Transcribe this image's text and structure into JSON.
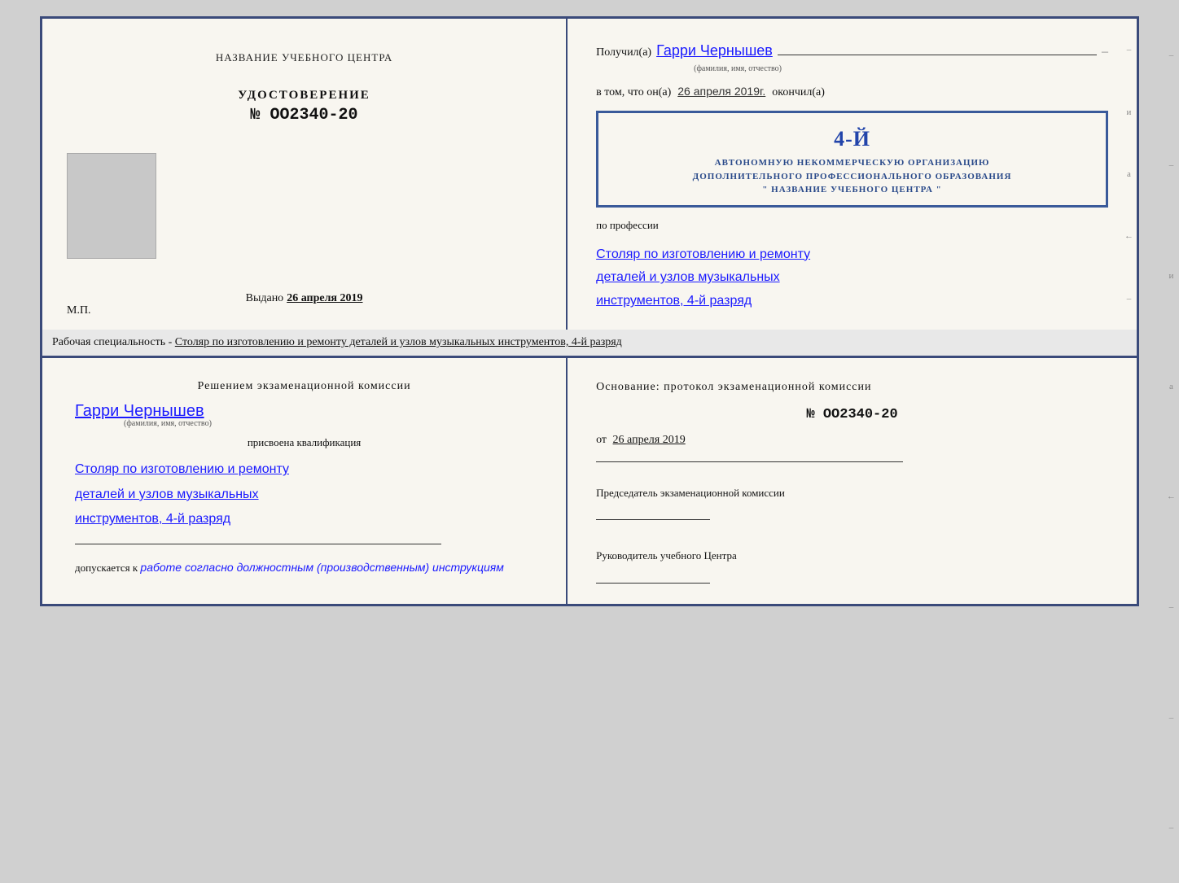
{
  "top_cert": {
    "left": {
      "org_name": "НАЗВАНИЕ УЧЕБНОГО ЦЕНТРА",
      "doc_title": "УДОСТОВЕРЕНИЕ",
      "doc_number": "№ OO2340-20",
      "issued_label": "Выдано",
      "issued_date": "26 апреля 2019",
      "mp": "М.П."
    },
    "right": {
      "received_label": "Получил(а)",
      "recipient_name": "Гарри Чернышев",
      "name_hint": "(фамилия, имя, отчество)",
      "in_that_label": "в том, что он(а)",
      "date": "26 апреля 2019г.",
      "finished_label": "окончил(а)",
      "stamp_line1": "АВТОНОМНУЮ НЕКОММЕРЧЕСКУЮ ОРГАНИЗАЦИЮ",
      "stamp_line2": "ДОПОЛНИТЕЛЬНОГО ПРОФЕССИОНАЛЬНОГО ОБРАЗОВАНИЯ",
      "stamp_line3": "\" НАЗВАНИЕ УЧЕБНОГО ЦЕНТРА \"",
      "stamp_number": "4-й",
      "profession_label": "по профессии",
      "profession_text": "Столяр по изготовлению и ремонту деталей и узлов музыкальных инструментов, 4-й разряд"
    }
  },
  "description": "Рабочая специальность - Столяр по изготовлению и ремонту деталей и узлов музыкальных инструментов, 4-й разряд",
  "bottom_cert": {
    "left": {
      "decision_title": "Решением  экзаменационной  комиссии",
      "recipient_name": "Гарри Чернышев",
      "name_hint": "(фамилия, имя, отчество)",
      "assigned_label": "присвоена квалификация",
      "qualification": "Столяр по изготовлению и ремонту деталей и узлов музыкальных инструментов, 4-й разряд",
      "admitted_label": "допускается к",
      "admitted_text": "работе согласно должностным (производственным) инструкциям"
    },
    "right": {
      "basis_label": "Основание: протокол экзаменационной  комиссии",
      "protocol_number": "№  OO2340-20",
      "date_prefix": "от",
      "date": "26 апреля 2019",
      "chairman_label": "Председатель экзаменационной комиссии",
      "director_label": "Руководитель учебного Центра"
    }
  },
  "side_chars": [
    "и",
    "а",
    "←",
    "–",
    "–",
    "–",
    "–"
  ]
}
